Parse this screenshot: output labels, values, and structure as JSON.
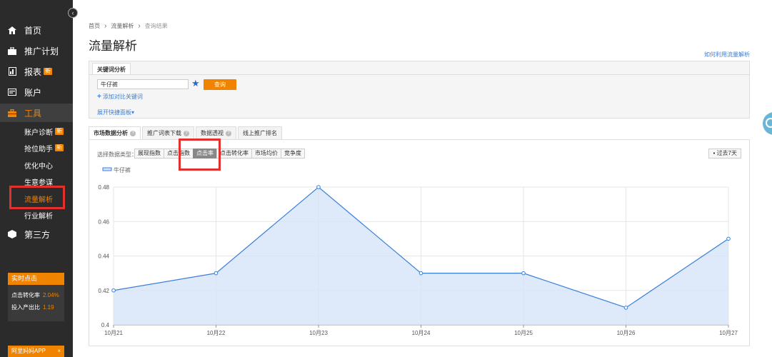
{
  "sidebar": {
    "collapse_glyph": "‹",
    "items": [
      {
        "label": "首页",
        "icon": "home-icon"
      },
      {
        "label": "推广计划",
        "icon": "briefcase-icon"
      },
      {
        "label": "报表",
        "icon": "report-icon",
        "badge": "新"
      },
      {
        "label": "账户",
        "icon": "account-icon"
      },
      {
        "label": "工具",
        "icon": "toolbox-icon"
      },
      {
        "label": "第三方",
        "icon": "cube-icon"
      }
    ],
    "sub_items": [
      {
        "label": "账户诊断",
        "badge": "新"
      },
      {
        "label": "抢位助手",
        "badge": "新"
      },
      {
        "label": "优化中心"
      },
      {
        "label": "生意参谋"
      },
      {
        "label": "流量解析"
      },
      {
        "label": "行业解析"
      }
    ],
    "realtime": {
      "title": "实时点击",
      "ctr_label": "点击转化率",
      "ctr_value": "2.04%",
      "roi_label": "投入产出比",
      "roi_value": "1.19"
    },
    "app_bar": {
      "label": "阿里妈妈APP",
      "close": "×"
    }
  },
  "breadcrumb": {
    "home": "首页",
    "sep": "›",
    "section": "流量解析",
    "current": "查询结果"
  },
  "page_title": "流量解析",
  "help_link": "如何利用流量解析",
  "keyword_panel": {
    "tab": "关键词分析",
    "input_value": "牛仔裤",
    "star": "★",
    "query_button": "查询",
    "add_compare": "添加对比关键词",
    "add_compare_plus": "+",
    "expand": "展开快捷面板▾"
  },
  "tabs": [
    {
      "label": "市场数据分析",
      "help": "?"
    },
    {
      "label": "推广词表下载",
      "help": "?"
    },
    {
      "label": "数据透视",
      "help": "?"
    },
    {
      "label": "线上推广排名"
    }
  ],
  "data_type": {
    "label": "选择数据类型：",
    "options": [
      "展现指数",
      "点击指数",
      "点击率",
      "点击转化率",
      "市场均价",
      "竞争度"
    ],
    "selected": "点击率"
  },
  "period_button": "过去7天",
  "chart_data": {
    "type": "area",
    "legend": [
      "牛仔裤"
    ],
    "categories": [
      "10月21",
      "10月22",
      "10月23",
      "10月24",
      "10月25",
      "10月26",
      "10月27"
    ],
    "series": [
      {
        "name": "牛仔裤",
        "values": [
          0.42,
          0.43,
          0.48,
          0.43,
          0.43,
          0.41,
          0.45
        ]
      }
    ],
    "ylim": [
      0.4,
      0.48
    ],
    "yticks": [
      "0.4",
      "0.42",
      "0.44",
      "0.46",
      "0.48"
    ],
    "grid": true,
    "colors": {
      "line": "#3a7fd9",
      "fill": "#d6e4f7"
    }
  }
}
